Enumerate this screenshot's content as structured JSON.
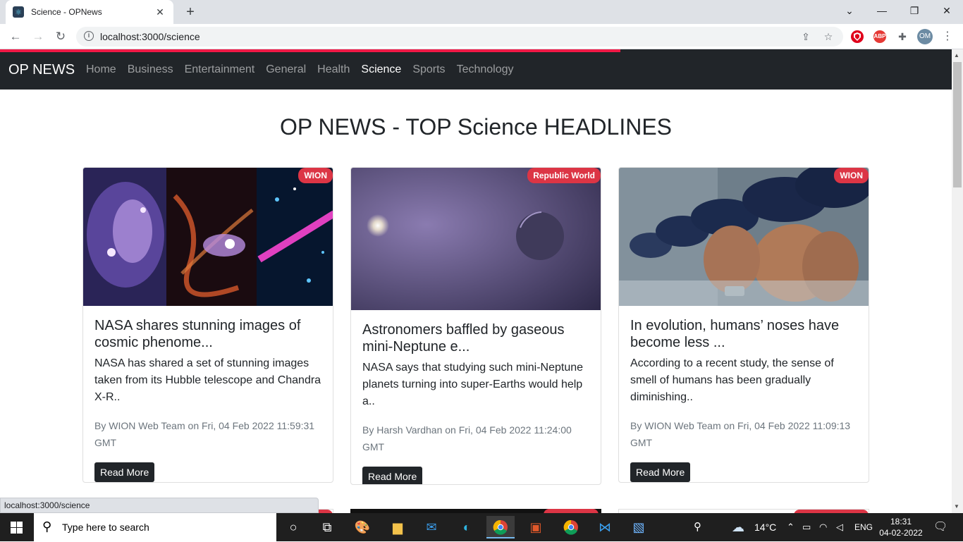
{
  "browser": {
    "tab_title": "Science - OPNews",
    "tab_close": "✕",
    "new_tab": "+",
    "url": "localhost:3000/science",
    "window_controls": {
      "dropdown": "⌄",
      "minimize": "—",
      "restore": "❐",
      "close": "✕"
    },
    "nav_icons": {
      "back": "←",
      "forward": "→",
      "reload": "↻"
    },
    "extensions": [
      {
        "name": "ublock-icon",
        "label": "",
        "color": "#e0001b"
      },
      {
        "name": "adblock-icon",
        "label": "ABP",
        "color": "#e53935"
      }
    ],
    "avatar": "OM",
    "status_url": "localhost:3000/science"
  },
  "app": {
    "brand": "OP NEWS",
    "nav": [
      "Home",
      "Business",
      "Entertainment",
      "General",
      "Health",
      "Science",
      "Sports",
      "Technology"
    ],
    "active_nav": "Science",
    "headline": "OP NEWS - TOP Science HEADLINES",
    "accent": "#dc3545",
    "progress_color": "#f11946"
  },
  "cards": [
    {
      "source": "WION",
      "title": "NASA shares stunning images of cosmic phenome...",
      "description": "NASA has shared a set of stunning images taken from its Hubble telescope and Chandra X-R..",
      "author": "WION Web Team",
      "date": "Fri, 04 Feb 2022 11:59:31 GMT",
      "button": "Read More"
    },
    {
      "source": "Republic World",
      "title": "Astronomers baffled by gaseous mini-Neptune e...",
      "description": "NASA says that studying such mini-Neptune planets turning into super-Earths would help a..",
      "author": "Harsh Vardhan",
      "date": "Fri, 04 Feb 2022 11:24:00 GMT",
      "button": "Read More"
    },
    {
      "source": "WION",
      "title": "In evolution, humans’ noses have become less ...",
      "description": "According to a recent study, the sense of smell of humans has been gradually diminishing..",
      "author": "WION Web Team",
      "date": "Fri, 04 Feb 2022 11:09:13 GMT",
      "button": "Read More"
    }
  ],
  "meta_labels": {
    "by": "By",
    "on": "on"
  },
  "taskbar": {
    "search_placeholder": "Type here to search",
    "temperature": "14°C",
    "language": "ENG",
    "time": "18:31",
    "date": "04-02-2022"
  }
}
